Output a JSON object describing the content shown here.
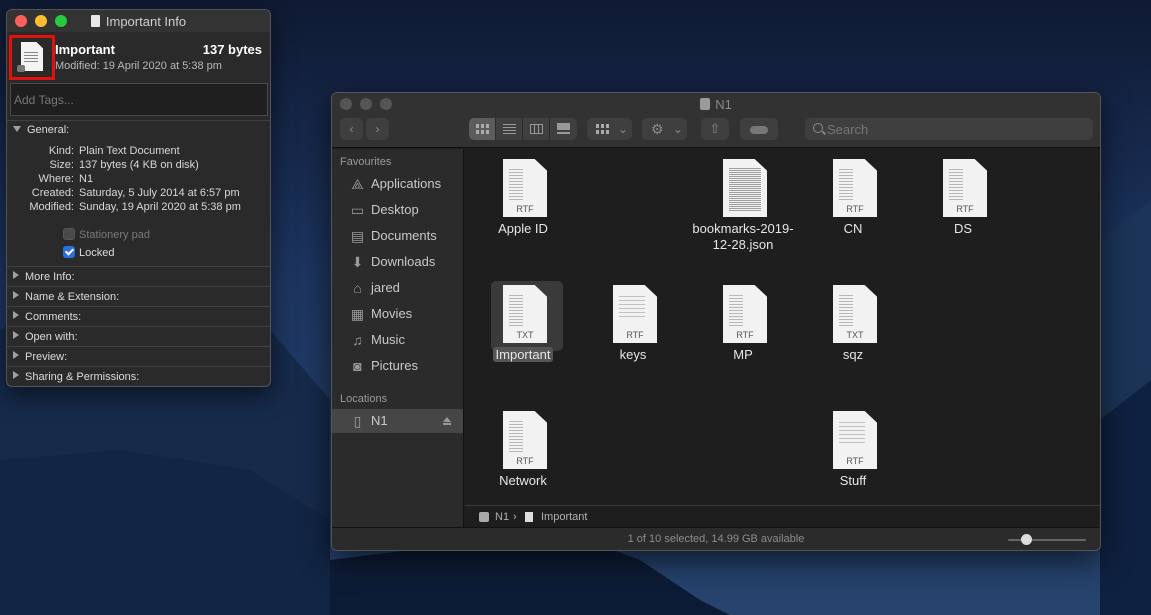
{
  "info_window": {
    "title": "Important Info",
    "file_name": "Important",
    "size_summary": "137 bytes",
    "modified_summary": "Modified: 19 April 2020 at 5:38 pm",
    "tags_placeholder": "Add Tags...",
    "general": {
      "header": "General:",
      "rows": [
        {
          "key": "Kind:",
          "value": "Plain Text Document"
        },
        {
          "key": "Size:",
          "value": "137 bytes (4 KB on disk)"
        },
        {
          "key": "Where:",
          "value": "N1"
        },
        {
          "key": "Created:",
          "value": "Saturday, 5 July 2014 at 6:57 pm"
        },
        {
          "key": "Modified:",
          "value": "Sunday, 19 April 2020 at 5:38 pm"
        }
      ],
      "stationery_pad_label": "Stationery pad",
      "locked_label": "Locked",
      "locked_checked": true
    },
    "sections": [
      "More Info:",
      "Name & Extension:",
      "Comments:",
      "Open with:",
      "Preview:",
      "Sharing & Permissions:"
    ]
  },
  "finder": {
    "title": "N1",
    "search_placeholder": "Search",
    "sidebar": {
      "favourites_header": "Favourites",
      "favourites": [
        {
          "label": "Applications",
          "icon": "applications-icon"
        },
        {
          "label": "Desktop",
          "icon": "desktop-icon"
        },
        {
          "label": "Documents",
          "icon": "documents-icon"
        },
        {
          "label": "Downloads",
          "icon": "downloads-icon"
        },
        {
          "label": "jared",
          "icon": "home-icon"
        },
        {
          "label": "Movies",
          "icon": "movies-icon"
        },
        {
          "label": "Music",
          "icon": "music-icon"
        },
        {
          "label": "Pictures",
          "icon": "pictures-icon"
        }
      ],
      "locations_header": "Locations",
      "locations": [
        {
          "label": "N1",
          "icon": "drive-icon"
        }
      ]
    },
    "files": [
      {
        "name": "Apple ID",
        "ext": "RTF"
      },
      {
        "name": "bookmarks-2019-12-28.json",
        "ext": ""
      },
      {
        "name": "CN",
        "ext": "RTF"
      },
      {
        "name": "DS",
        "ext": "RTF"
      },
      {
        "name": "Important",
        "ext": "TXT"
      },
      {
        "name": "keys",
        "ext": "RTF"
      },
      {
        "name": "MP",
        "ext": "RTF"
      },
      {
        "name": "sqz",
        "ext": "TXT"
      },
      {
        "name": "Network",
        "ext": "RTF"
      },
      {
        "name": "Stuff",
        "ext": "RTF"
      }
    ],
    "path": {
      "disk": "N1",
      "separator": "›",
      "file": "Important"
    },
    "status": "1 of 10 selected, 14.99 GB available"
  }
}
